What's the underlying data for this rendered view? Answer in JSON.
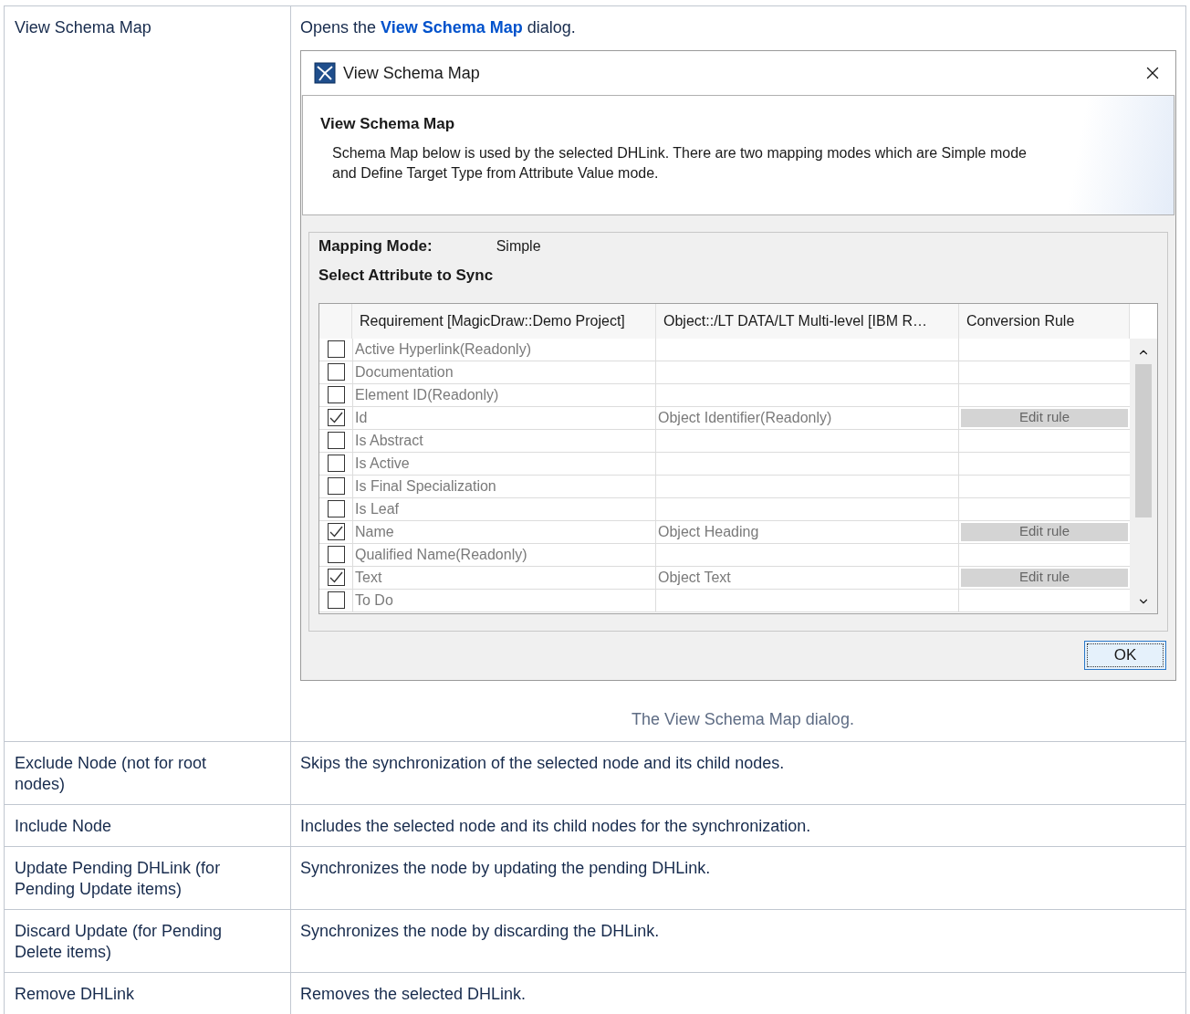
{
  "rows": [
    {
      "term": "View Schema Map",
      "description": [
        {
          "kind": "text",
          "text": "Opens the "
        },
        {
          "kind": "link",
          "text": "View Schema Map"
        },
        {
          "kind": "text",
          "text": " dialog."
        }
      ],
      "figure": {
        "dialog": {
          "title": "View Schema Map",
          "header_title": "View Schema Map",
          "header_text": "Schema Map below is used by the selected DHLink. There are two mapping modes which are Simple mode and Define Target Type from Attribute Value mode.",
          "mapping_mode_label": "Mapping Mode:",
          "mapping_mode_value": "Simple",
          "section_title": "Select Attribute to Sync",
          "columns": [
            "Requirement [MagicDraw::Demo Project]",
            "Object::/LT DATA/LT Multi-level [IBM R…",
            "Conversion Rule"
          ],
          "table_rows": [
            {
              "checked": false,
              "requirement": "Active Hyperlink(Readonly)"
            },
            {
              "checked": false,
              "requirement": "Documentation"
            },
            {
              "checked": false,
              "requirement": "Element ID(Readonly)"
            },
            {
              "checked": true,
              "requirement": "Id",
              "object": "Object Identifier(Readonly)",
              "rule": "Edit rule"
            },
            {
              "checked": false,
              "requirement": "Is Abstract"
            },
            {
              "checked": false,
              "requirement": "Is Active"
            },
            {
              "checked": false,
              "requirement": "Is Final Specialization"
            },
            {
              "checked": false,
              "requirement": "Is Leaf"
            },
            {
              "checked": true,
              "requirement": "Name",
              "object": "Object Heading",
              "rule": "Edit rule"
            },
            {
              "checked": false,
              "requirement": "Qualified Name(Readonly)"
            },
            {
              "checked": true,
              "requirement": "Text",
              "object": "Object Text",
              "rule": "Edit rule"
            },
            {
              "checked": false,
              "requirement": "To Do"
            }
          ],
          "ok_button": "OK"
        },
        "caption": "The View Schema Map dialog."
      }
    },
    {
      "term": "Exclude Node (not for root nodes)",
      "description": [
        {
          "kind": "text",
          "text": "Skips the synchronization of the selected node and its child nodes."
        }
      ]
    },
    {
      "term": "Include Node",
      "description": [
        {
          "kind": "text",
          "text": "Includes the selected node and its child nodes for the synchronization."
        }
      ]
    },
    {
      "term": "Update Pending DHLink (for Pending Update items)",
      "description": [
        {
          "kind": "text",
          "text": "Synchronizes the node by updating the pending DHLink."
        }
      ]
    },
    {
      "term": "Discard Update (for Pending Delete items)",
      "description": [
        {
          "kind": "text",
          "text": "Synchronizes the node by discarding the DHLink."
        }
      ]
    },
    {
      "term": "Remove DHLink",
      "description": [
        {
          "kind": "text",
          "text": "Removes the selected DHLink."
        }
      ]
    }
  ]
}
